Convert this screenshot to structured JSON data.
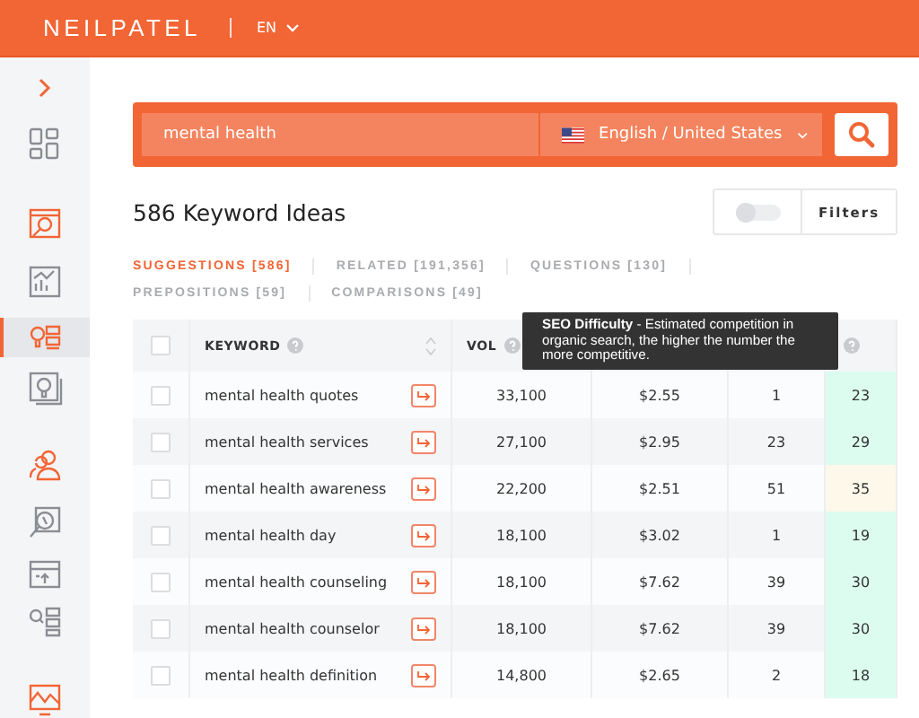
{
  "header": {
    "logo": "NEILPATEL",
    "language": "EN"
  },
  "sidebar": {
    "items": [
      {
        "selected": false,
        "color": "#8a8d93"
      },
      {
        "selected": false,
        "color": "#f26535"
      },
      {
        "selected": false,
        "color": "#8a8d93"
      },
      {
        "selected": true,
        "color": "#f26535"
      },
      {
        "selected": false,
        "color": "#8a8d93"
      },
      {
        "selected": false,
        "color": "#f26535"
      },
      {
        "selected": false,
        "color": "#8a8d93"
      },
      {
        "selected": false,
        "color": "#8a8d93"
      },
      {
        "selected": false,
        "color": "#8a8d93"
      },
      {
        "selected": false,
        "color": "#f26535"
      }
    ]
  },
  "search": {
    "value": "mental health",
    "locale": "English / United States"
  },
  "results_title": "586 Keyword Ideas",
  "filters": {
    "toggle_on": false,
    "label": "Filters"
  },
  "tabs": [
    {
      "label": "SUGGESTIONS [586]",
      "selected": true
    },
    {
      "label": "RELATED [191,356]",
      "selected": false
    },
    {
      "label": "QUESTIONS [130]",
      "selected": false
    },
    {
      "label": "PREPOSITIONS [59]",
      "selected": false
    },
    {
      "label": "COMPARISONS [49]",
      "selected": false
    }
  ],
  "table": {
    "select_all_checked": false,
    "columns": [
      {
        "label": "KEYWORD"
      },
      {
        "label": "VOL"
      }
    ],
    "rows": [
      {
        "checked": false,
        "keyword": "mental health quotes",
        "vol": "33,100",
        "cpc": "$2.55",
        "pd": "1",
        "sd": "23",
        "color": "#dcfcef"
      },
      {
        "checked": false,
        "keyword": "mental health services",
        "vol": "27,100",
        "cpc": "$2.95",
        "pd": "23",
        "sd": "29",
        "color": "#dcfcef"
      },
      {
        "checked": false,
        "keyword": "mental health awareness",
        "vol": "22,200",
        "cpc": "$2.51",
        "pd": "51",
        "sd": "35",
        "color": "#fdf8ea"
      },
      {
        "checked": false,
        "keyword": "mental health day",
        "vol": "18,100",
        "cpc": "$3.02",
        "pd": "1",
        "sd": "19",
        "color": "#dcfcef"
      },
      {
        "checked": false,
        "keyword": "mental health counseling",
        "vol": "18,100",
        "cpc": "$7.62",
        "pd": "39",
        "sd": "30",
        "color": "#dcfcef"
      },
      {
        "checked": false,
        "keyword": "mental health counselor",
        "vol": "18,100",
        "cpc": "$7.62",
        "pd": "39",
        "sd": "30",
        "color": "#dcfcef"
      },
      {
        "checked": false,
        "keyword": "mental health definition",
        "vol": "14,800",
        "cpc": "$2.65",
        "pd": "2",
        "sd": "18",
        "color": "#dcfcef"
      }
    ]
  },
  "tooltip": "**SEO Difficulty** - Estimated competition in organic search, the higher the number the more competitive."
}
